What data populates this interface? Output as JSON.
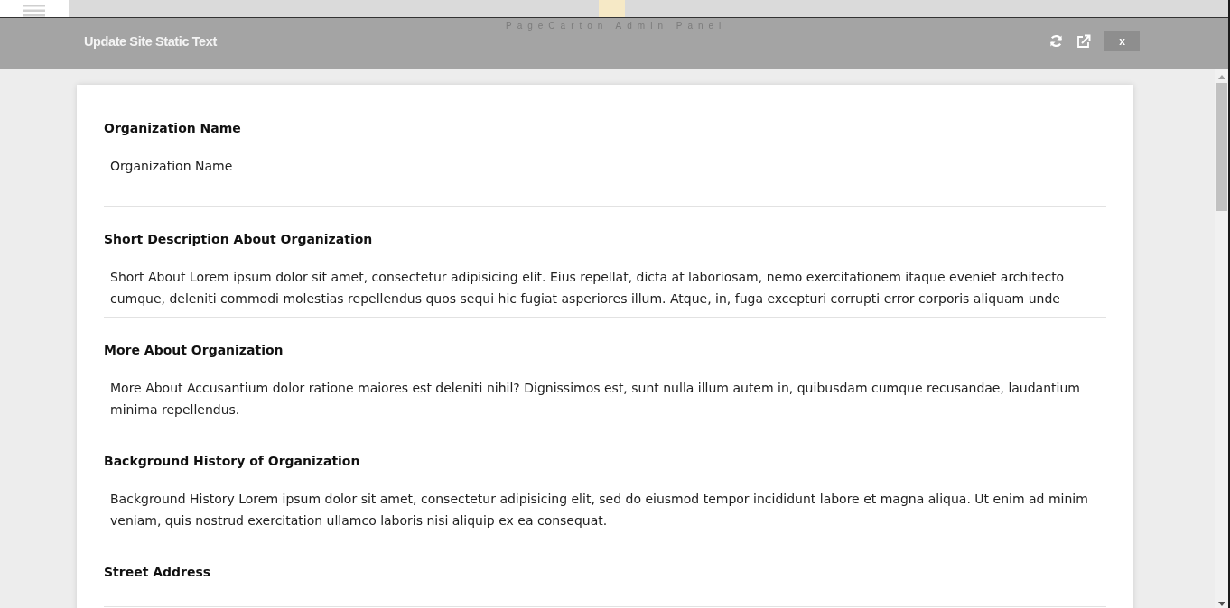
{
  "background": {
    "brand_text": "PageCarton Admin Panel"
  },
  "dialog": {
    "title": "Update Site Static Text",
    "close_label": "x"
  },
  "fields": [
    {
      "label": "Organization Name",
      "value": "Organization Name"
    },
    {
      "label": "Short Description About Organization",
      "value": "Short About Lorem ipsum dolor sit amet, consectetur adipisicing elit. Eius repellat, dicta at laboriosam, nemo exercitationem itaque eveniet architecto cumque, deleniti commodi molestias repellendus quos sequi hic fugiat asperiores illum. Atque, in, fuga excepturi corrupti error corporis aliquam unde"
    },
    {
      "label": "More About Organization",
      "value": "More About Accusantium dolor ratione maiores est deleniti nihil? Dignissimos est, sunt nulla illum autem in, quibusdam cumque recusandae, laudantium minima repellendus."
    },
    {
      "label": "Background History of Organization",
      "value": "Background History Lorem ipsum dolor sit amet, consectetur adipisicing elit, sed do eiusmod tempor incididunt labore et magna aliqua. Ut enim ad minim veniam, quis nostrud exercitation ullamco laboris nisi aliquip ex ea consequat."
    },
    {
      "label": "Street Address"
    }
  ]
}
